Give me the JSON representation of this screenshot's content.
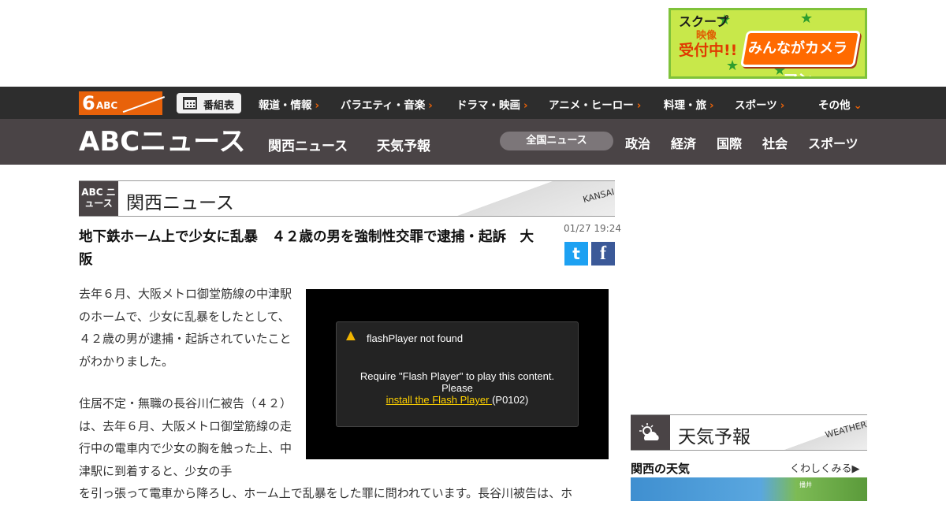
{
  "banner": {
    "line1": "スクープ",
    "line2": "映像",
    "line3": "受付中!!",
    "cam_text": "みんながカメラマン"
  },
  "topnav": {
    "logo_six": "6",
    "logo_abc": "ABC",
    "guide_label": "番組表",
    "items": [
      "報道・情報",
      "バラエティ・音楽",
      "ドラマ・映画",
      "アニメ・ヒーロー",
      "料理・旅",
      "スポーツ",
      "その他"
    ]
  },
  "newsbar": {
    "logo": "ABCニュース",
    "links": [
      "関西ニュース",
      "天気予報"
    ],
    "active_category": "全国ニュース",
    "categories": [
      "政治",
      "経済",
      "国際",
      "社会",
      "スポーツ"
    ]
  },
  "section": {
    "badge": "ABC ニュース",
    "title": "関西ニュース",
    "tag": "KANSAI"
  },
  "article": {
    "headline": "地下鉄ホーム上で少女に乱暴　４２歳の男を強制性交罪で逮捕・起訴　大阪",
    "date": "01/27 19:24",
    "share_twitter": "t",
    "share_facebook": "f",
    "para1": "去年６月、大阪メトロ御堂筋線の中津駅のホームで、少女に乱暴をしたとして、４２歳の男が逮捕・起訴されていたことがわかりました。",
    "para2": "住居不定・無職の長谷川仁被告（４２）は、去年６月、大阪メトロ御堂筋線の走行中の電車内で少女の胸を触った上、中津駅に到着すると、少女の手",
    "para3": "を引っ張って電車から降ろし、ホーム上で乱暴をした罪に問われています。長谷川被告は、ホ"
  },
  "player": {
    "title": "flashPlayer not found",
    "line1": "Require \"Flash Player\" to play this content.",
    "line2": "Please",
    "link": "install the Flash Player ",
    "code": "(P0102)"
  },
  "weather": {
    "badge": "",
    "title": "天気予報",
    "tag": "WEATHER",
    "subtitle": "関西の天気",
    "more": "くわしくみる▶",
    "place": "播井"
  },
  "colors": {
    "accent": "#e8620a",
    "nav_bg": "#2d2d2d",
    "newsbar_bg": "#4a4446",
    "twitter": "#1da1f2",
    "facebook": "#3b5998",
    "banner_bg": "#c8e84a"
  }
}
